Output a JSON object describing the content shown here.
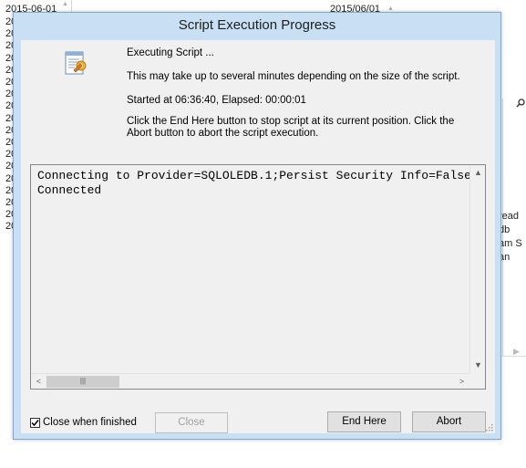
{
  "background": {
    "top_left_date": "2015-06-01",
    "top_mid_date": "2015/06/01",
    "left_column_rows": [
      "20",
      "20",
      "20",
      "20",
      "20",
      "20",
      "20",
      "20",
      "20",
      "20",
      "20",
      "20",
      "20",
      "20",
      "20",
      "20",
      "20",
      "20"
    ],
    "right_pane_lines": [
      "read",
      "db",
      "am S",
      "an"
    ]
  },
  "dialog": {
    "title": "Script Execution Progress",
    "status_line": "Executing Script ...",
    "info_line": "This may take up to several minutes depending on the size of the script.",
    "timing_line": "Started at 06:36:40, Elapsed: 00:00:01",
    "instruction_line": "Click the End Here button to stop script at its current position. Click the Abort button to abort the script execution.",
    "output_lines": [
      "Connecting to Provider=SQLOLEDB.1;Persist Security Info=False",
      "Connected"
    ],
    "close_when_finished_label": "Close when finished",
    "close_when_finished_checked": true,
    "close_button": "Close",
    "end_here_button": "End Here",
    "abort_button": "Abort"
  },
  "icons": {
    "script": "script-document-icon",
    "checkmark": "checkmark-icon",
    "search": "search-icon",
    "grip": "resize-grip-icon"
  },
  "colors": {
    "dialog_frame": "#c9e0f4",
    "dialog_border": "#7fa7cf",
    "client_background": "#f0f0f0",
    "button_face": "#e1e1e1",
    "disabled_text": "#a0a0a0"
  }
}
